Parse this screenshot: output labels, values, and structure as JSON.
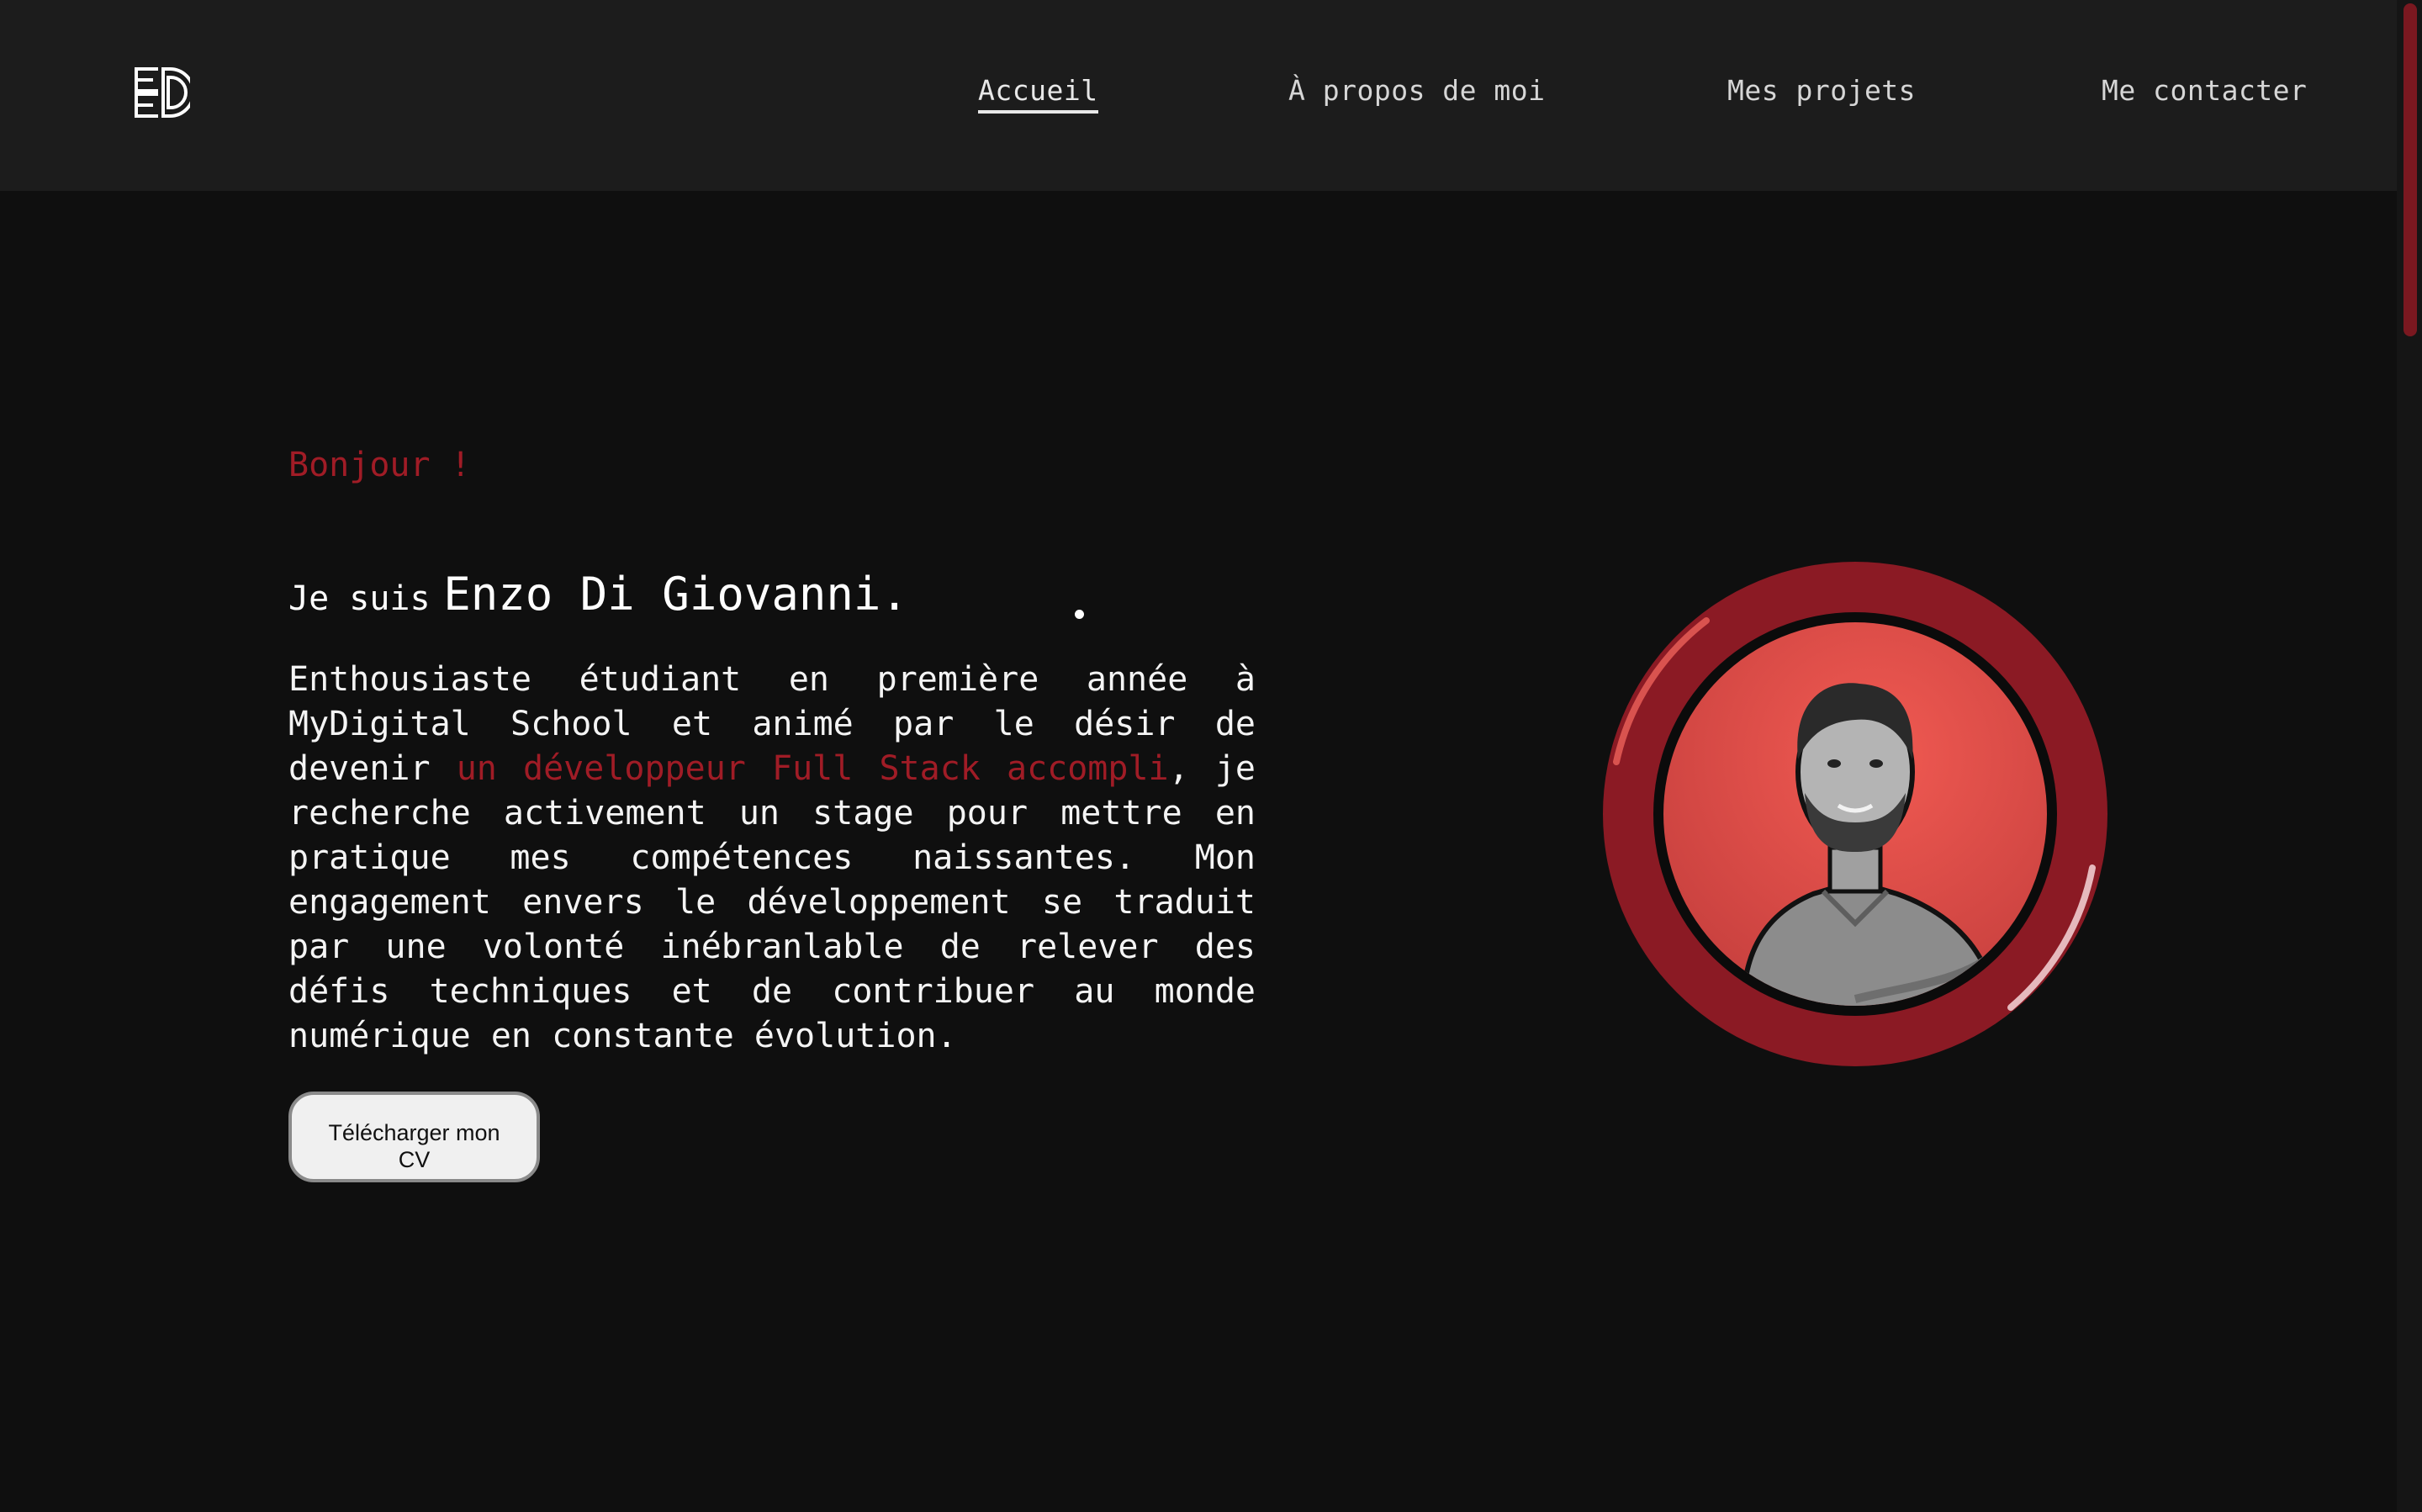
{
  "header": {
    "logo_icon": "ed-monogram-logo",
    "nav": [
      {
        "label": "Accueil",
        "active": true
      },
      {
        "label": "À propos de moi",
        "active": false
      },
      {
        "label": "Mes projets",
        "active": false
      },
      {
        "label": "Me contacter",
        "active": false
      }
    ]
  },
  "hero": {
    "greeting": "Bonjour !",
    "intro_prefix": "Je suis",
    "name": "Enzo Di Giovanni.",
    "description_start": "Enthousiaste étudiant en première année à MyDigital School et animé par le désir de devenir ",
    "description_highlight": "un développeur Full Stack accompli",
    "description_end": ", je recherche activement un stage pour mettre en pratique mes compétences naissantes. Mon engagement envers le développement se traduit par une volonté inébranlable de relever des défis techniques et de contribuer au monde numérique en constante évolution.",
    "cv_button": "Télécharger mon CV",
    "portrait_icon": "profile-photo"
  },
  "colors": {
    "accent": "#a01c26",
    "ring": "#8b1a24",
    "photo_bg": "#e8504a",
    "header_bg": "#1c1c1c",
    "page_bg": "#0f0f0f"
  }
}
